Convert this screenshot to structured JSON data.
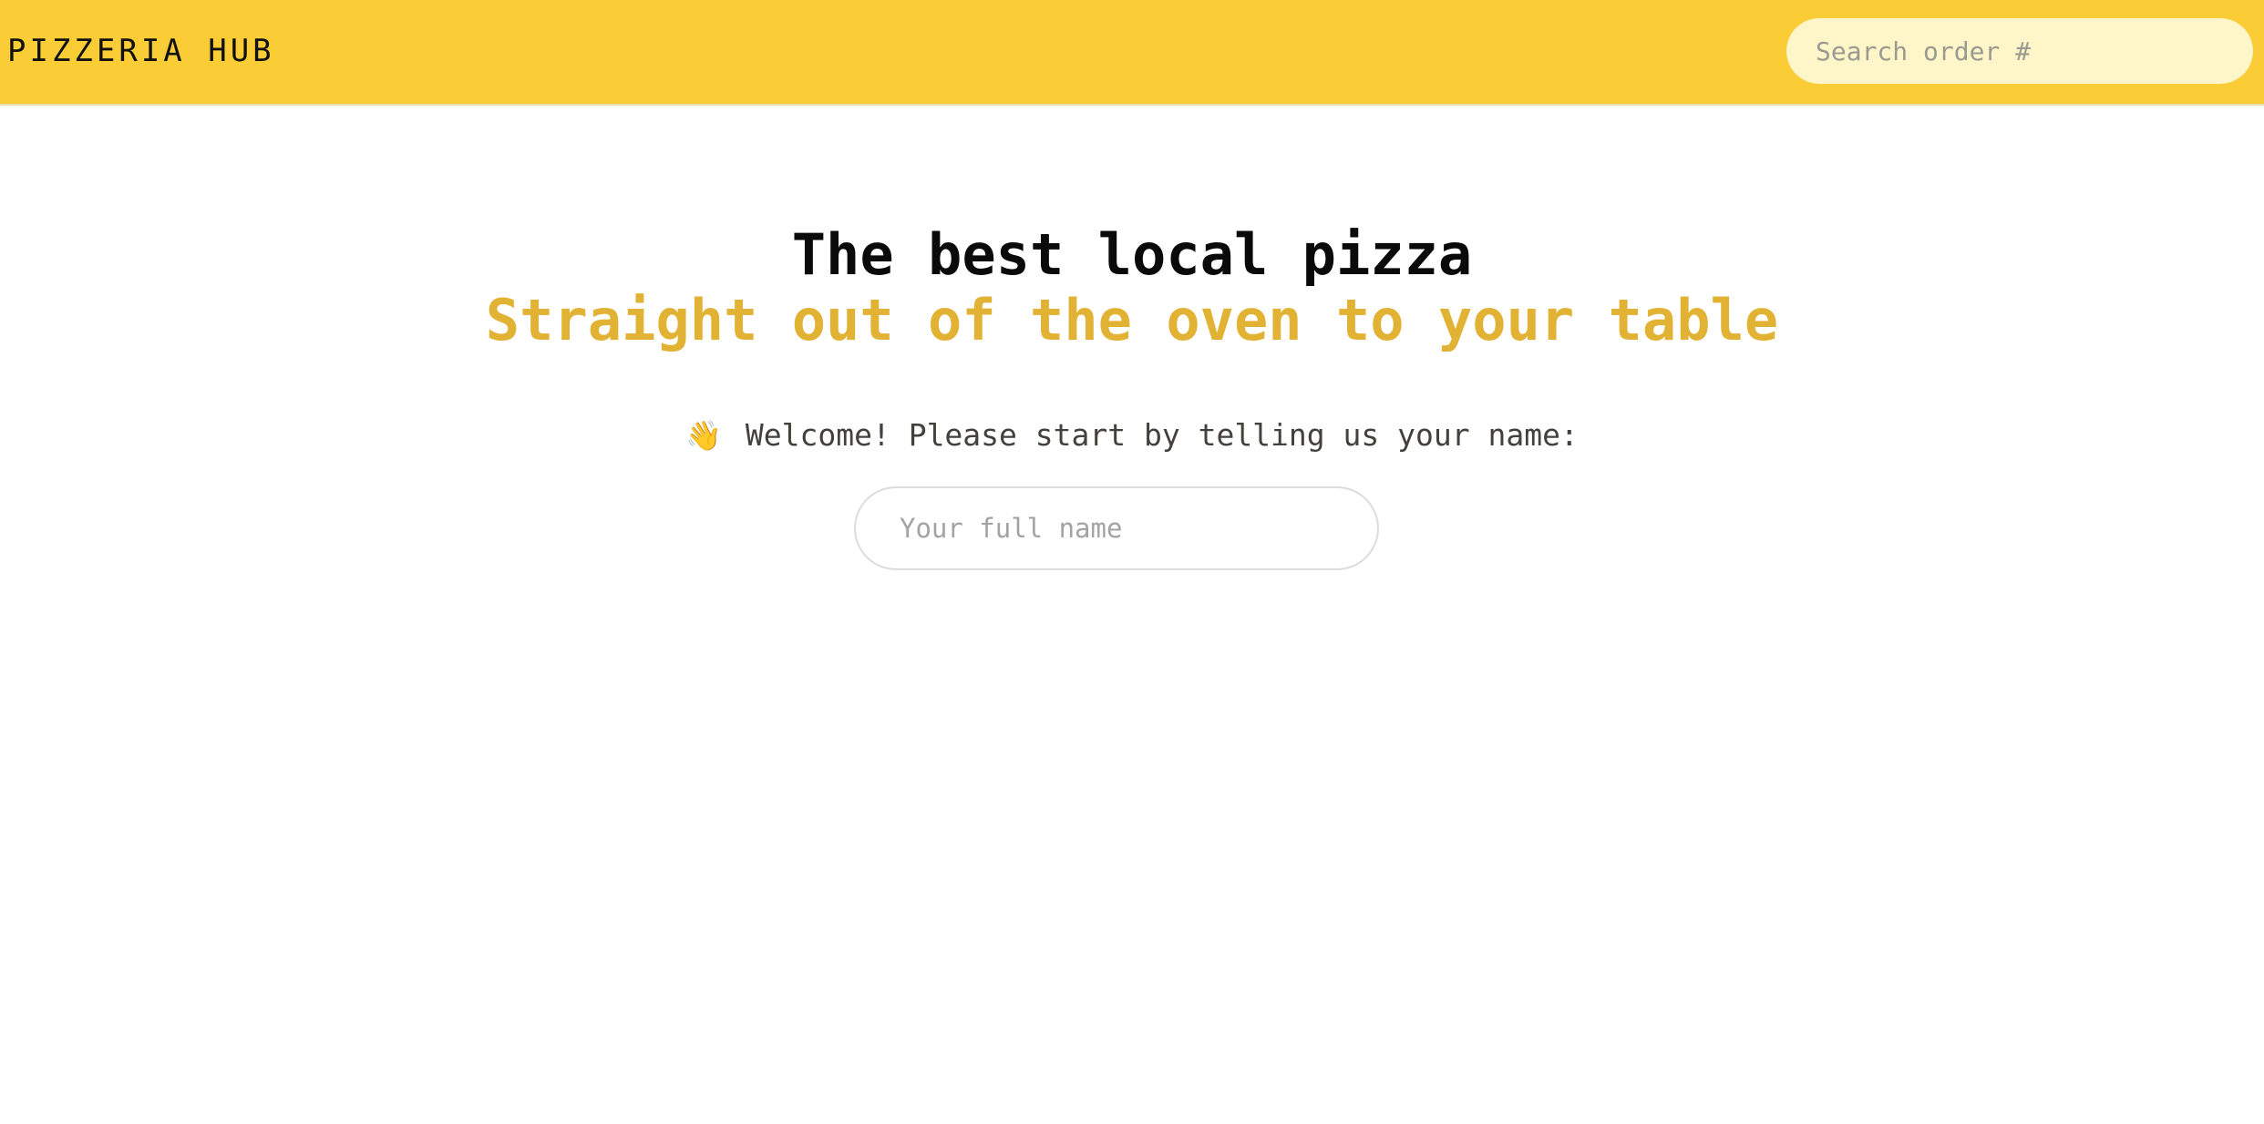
{
  "header": {
    "logo_text": "PIZZERIA HUB",
    "search_placeholder": "Search order #",
    "background_color": "#FACC35"
  },
  "hero": {
    "title": "The best local pizza",
    "subtitle": "Straight out of the oven to your table",
    "subtitle_color": "#E2B234"
  },
  "welcome": {
    "icon": "waving-hand-icon",
    "emoji": "👋",
    "text": "Welcome! Please start by telling us your name:"
  },
  "name_form": {
    "placeholder": "Your full name",
    "value": ""
  }
}
